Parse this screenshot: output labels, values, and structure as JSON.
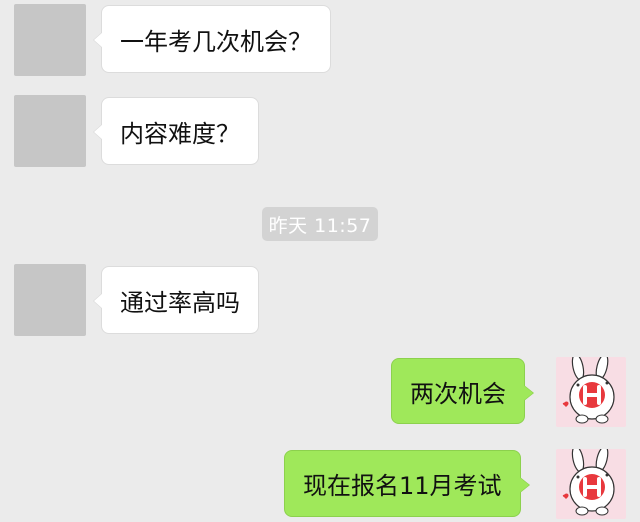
{
  "messages": [
    {
      "side": "left",
      "text": "一年考几次机会？",
      "avatar": "blurred-avatar"
    },
    {
      "side": "left",
      "text": "内容难度？",
      "avatar": "blurred-avatar"
    },
    {
      "side": "left",
      "text": "通过率高吗",
      "avatar": "blurred-avatar"
    },
    {
      "side": "right",
      "text": "两次机会",
      "avatar": "rabbit-h-avatar"
    },
    {
      "side": "right",
      "text": "现在报名11月考试",
      "avatar": "rabbit-h-avatar"
    }
  ],
  "timestamp": "昨天 11:57",
  "colors": {
    "background": "#ebebeb",
    "incoming_bubble": "#ffffff",
    "outgoing_bubble": "#9fe85a",
    "timestamp_bg": "#d3d3d3",
    "avatar_accent": "#e8383d"
  }
}
